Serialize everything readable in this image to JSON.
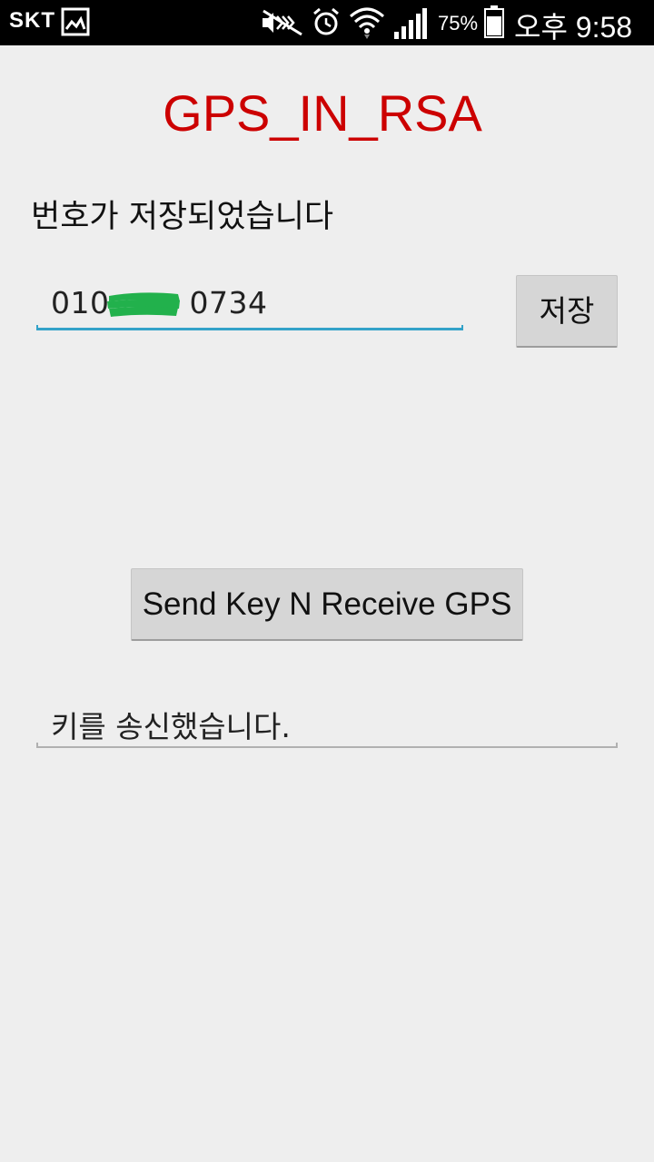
{
  "status_bar": {
    "carrier": "SKT",
    "battery_percent": "75%",
    "time": "오후 9:58",
    "icons": [
      "gallery-icon",
      "mute-icon",
      "alarm-icon",
      "wifi-icon",
      "signal-icon",
      "battery-icon"
    ]
  },
  "app": {
    "title": "GPS_IN_RSA",
    "title_color": "#cc0000",
    "status_message": "번호가 저장되었습니다",
    "phone_field": {
      "value": "010",
      "value_suffix": "0734",
      "accent_color": "#33a2c8"
    },
    "save_button_label": "저장",
    "send_button_label": "Send Key N Receive GPS",
    "result_text": "키를 송신했습니다."
  },
  "colors": {
    "background": "#eeeeee",
    "status_bar": "#000000",
    "button": "#d6d6d6",
    "redaction": "#22b14c"
  }
}
